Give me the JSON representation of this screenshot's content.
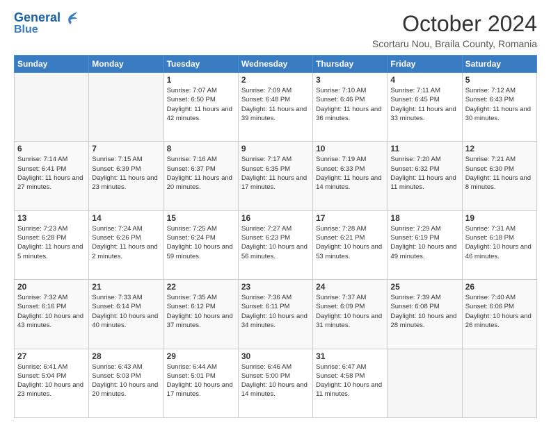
{
  "header": {
    "logo_line1": "General",
    "logo_line2": "Blue",
    "month": "October 2024",
    "location": "Scortaru Nou, Braila County, Romania"
  },
  "days_of_week": [
    "Sunday",
    "Monday",
    "Tuesday",
    "Wednesday",
    "Thursday",
    "Friday",
    "Saturday"
  ],
  "weeks": [
    [
      {
        "num": "",
        "text": ""
      },
      {
        "num": "",
        "text": ""
      },
      {
        "num": "1",
        "text": "Sunrise: 7:07 AM\nSunset: 6:50 PM\nDaylight: 11 hours and 42 minutes."
      },
      {
        "num": "2",
        "text": "Sunrise: 7:09 AM\nSunset: 6:48 PM\nDaylight: 11 hours and 39 minutes."
      },
      {
        "num": "3",
        "text": "Sunrise: 7:10 AM\nSunset: 6:46 PM\nDaylight: 11 hours and 36 minutes."
      },
      {
        "num": "4",
        "text": "Sunrise: 7:11 AM\nSunset: 6:45 PM\nDaylight: 11 hours and 33 minutes."
      },
      {
        "num": "5",
        "text": "Sunrise: 7:12 AM\nSunset: 6:43 PM\nDaylight: 11 hours and 30 minutes."
      }
    ],
    [
      {
        "num": "6",
        "text": "Sunrise: 7:14 AM\nSunset: 6:41 PM\nDaylight: 11 hours and 27 minutes."
      },
      {
        "num": "7",
        "text": "Sunrise: 7:15 AM\nSunset: 6:39 PM\nDaylight: 11 hours and 23 minutes."
      },
      {
        "num": "8",
        "text": "Sunrise: 7:16 AM\nSunset: 6:37 PM\nDaylight: 11 hours and 20 minutes."
      },
      {
        "num": "9",
        "text": "Sunrise: 7:17 AM\nSunset: 6:35 PM\nDaylight: 11 hours and 17 minutes."
      },
      {
        "num": "10",
        "text": "Sunrise: 7:19 AM\nSunset: 6:33 PM\nDaylight: 11 hours and 14 minutes."
      },
      {
        "num": "11",
        "text": "Sunrise: 7:20 AM\nSunset: 6:32 PM\nDaylight: 11 hours and 11 minutes."
      },
      {
        "num": "12",
        "text": "Sunrise: 7:21 AM\nSunset: 6:30 PM\nDaylight: 11 hours and 8 minutes."
      }
    ],
    [
      {
        "num": "13",
        "text": "Sunrise: 7:23 AM\nSunset: 6:28 PM\nDaylight: 11 hours and 5 minutes."
      },
      {
        "num": "14",
        "text": "Sunrise: 7:24 AM\nSunset: 6:26 PM\nDaylight: 11 hours and 2 minutes."
      },
      {
        "num": "15",
        "text": "Sunrise: 7:25 AM\nSunset: 6:24 PM\nDaylight: 10 hours and 59 minutes."
      },
      {
        "num": "16",
        "text": "Sunrise: 7:27 AM\nSunset: 6:23 PM\nDaylight: 10 hours and 56 minutes."
      },
      {
        "num": "17",
        "text": "Sunrise: 7:28 AM\nSunset: 6:21 PM\nDaylight: 10 hours and 53 minutes."
      },
      {
        "num": "18",
        "text": "Sunrise: 7:29 AM\nSunset: 6:19 PM\nDaylight: 10 hours and 49 minutes."
      },
      {
        "num": "19",
        "text": "Sunrise: 7:31 AM\nSunset: 6:18 PM\nDaylight: 10 hours and 46 minutes."
      }
    ],
    [
      {
        "num": "20",
        "text": "Sunrise: 7:32 AM\nSunset: 6:16 PM\nDaylight: 10 hours and 43 minutes."
      },
      {
        "num": "21",
        "text": "Sunrise: 7:33 AM\nSunset: 6:14 PM\nDaylight: 10 hours and 40 minutes."
      },
      {
        "num": "22",
        "text": "Sunrise: 7:35 AM\nSunset: 6:12 PM\nDaylight: 10 hours and 37 minutes."
      },
      {
        "num": "23",
        "text": "Sunrise: 7:36 AM\nSunset: 6:11 PM\nDaylight: 10 hours and 34 minutes."
      },
      {
        "num": "24",
        "text": "Sunrise: 7:37 AM\nSunset: 6:09 PM\nDaylight: 10 hours and 31 minutes."
      },
      {
        "num": "25",
        "text": "Sunrise: 7:39 AM\nSunset: 6:08 PM\nDaylight: 10 hours and 28 minutes."
      },
      {
        "num": "26",
        "text": "Sunrise: 7:40 AM\nSunset: 6:06 PM\nDaylight: 10 hours and 26 minutes."
      }
    ],
    [
      {
        "num": "27",
        "text": "Sunrise: 6:41 AM\nSunset: 5:04 PM\nDaylight: 10 hours and 23 minutes."
      },
      {
        "num": "28",
        "text": "Sunrise: 6:43 AM\nSunset: 5:03 PM\nDaylight: 10 hours and 20 minutes."
      },
      {
        "num": "29",
        "text": "Sunrise: 6:44 AM\nSunset: 5:01 PM\nDaylight: 10 hours and 17 minutes."
      },
      {
        "num": "30",
        "text": "Sunrise: 6:46 AM\nSunset: 5:00 PM\nDaylight: 10 hours and 14 minutes."
      },
      {
        "num": "31",
        "text": "Sunrise: 6:47 AM\nSunset: 4:58 PM\nDaylight: 10 hours and 11 minutes."
      },
      {
        "num": "",
        "text": ""
      },
      {
        "num": "",
        "text": ""
      }
    ]
  ]
}
